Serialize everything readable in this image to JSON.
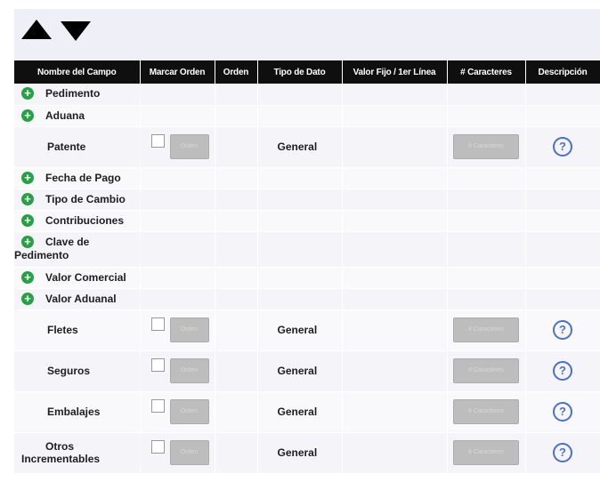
{
  "columns": [
    "Nombre del Campo",
    "Marcar Orden",
    "Orden",
    "Tipo de Dato",
    "Valor Fijo / 1er Línea",
    "# Caracteres",
    "Descripción"
  ],
  "group_rows": [
    {
      "label": "Pedimento"
    },
    {
      "label": "Aduana"
    }
  ],
  "patente": {
    "label": "Patente",
    "tipo": "General",
    "orden_placeholder": "Orden",
    "chars_placeholder": "# Caracteres"
  },
  "group_rows2": [
    {
      "label": "Fecha de Pago"
    },
    {
      "label": "Tipo de Cambio"
    },
    {
      "label": "Contribuciones"
    },
    {
      "label_line1": "Clave de",
      "label_line2": "Pedimento"
    },
    {
      "label": "Valor Comercial"
    },
    {
      "label": "Valor Aduanal"
    }
  ],
  "field_rows": [
    {
      "label": "Fletes",
      "tipo": "General",
      "orden_placeholder": "Orden",
      "chars_placeholder": "# Caracteres"
    },
    {
      "label": "Seguros",
      "tipo": "General",
      "orden_placeholder": "Orden",
      "chars_placeholder": "# Caracteres"
    },
    {
      "label": "Embalajes",
      "tipo": "General",
      "orden_placeholder": "Orden",
      "chars_placeholder": "# Caracteres"
    },
    {
      "label_line1": "Otros",
      "label_line2": "Incrementables",
      "tipo": "General",
      "orden_placeholder": "Orden",
      "chars_placeholder": "# Caracteres"
    }
  ],
  "icons": {
    "sort_up": "triangle-up-icon",
    "sort_down": "triangle-down-icon",
    "expand": "plus-circle-icon",
    "help": "question-circle-icon"
  },
  "colors": {
    "header_bg": "#0f0f0f",
    "plus_green": "#25a244",
    "help_blue": "#4a6fd8",
    "band": "#efeff8"
  }
}
